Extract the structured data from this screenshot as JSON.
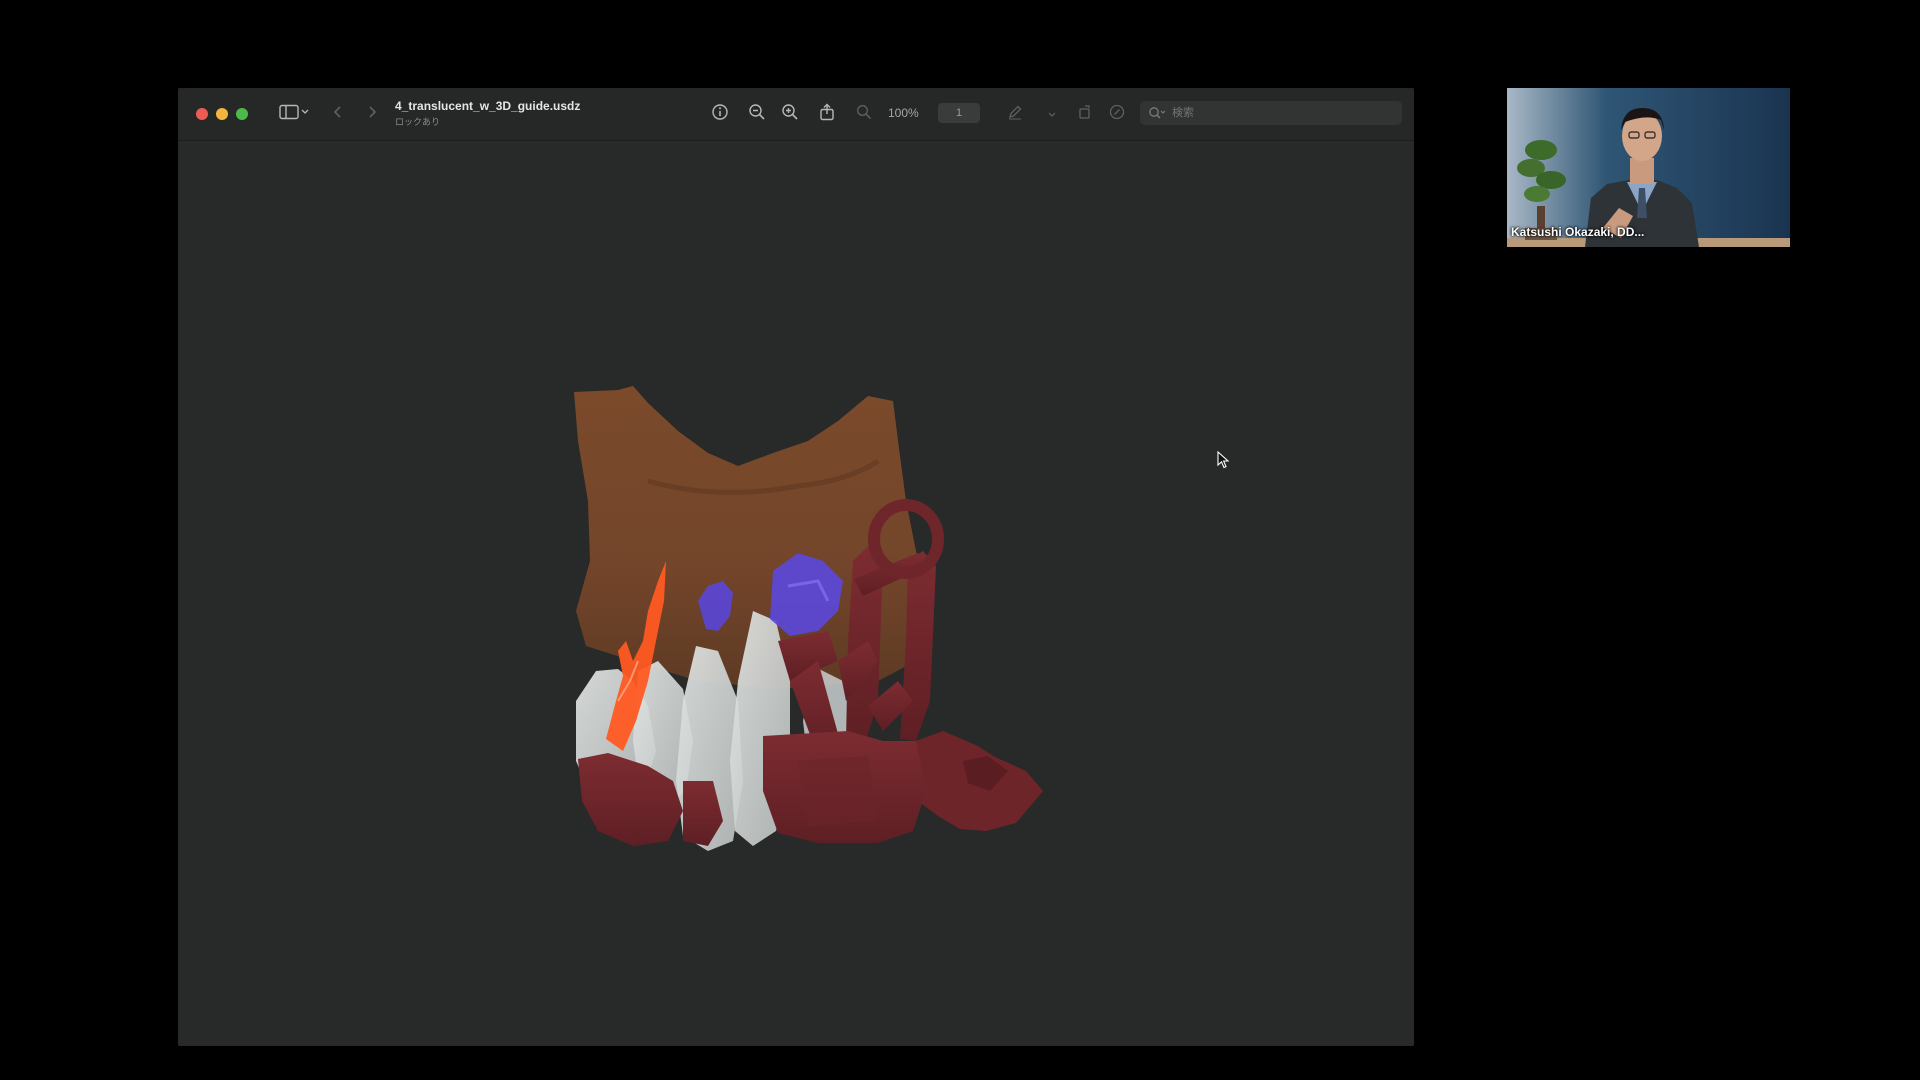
{
  "window": {
    "title": "4_translucent_w_3D_guide.usdz",
    "subtitle": "ロックあり",
    "zoom": "100%",
    "page_number": "1",
    "search_placeholder": "検索"
  },
  "video": {
    "participant_name": "Katsushi Okazaki, DD..."
  },
  "icons": {
    "sidebar": "sidebar-icon",
    "back": "chevron-left-icon",
    "forward": "chevron-right-icon",
    "info": "info-icon",
    "zoom_out": "zoom-out-icon",
    "zoom_in": "zoom-in-icon",
    "share": "share-icon",
    "zoom_fit": "zoom-fit-icon",
    "markup": "pen-icon",
    "rotate": "rotate-icon",
    "annotate": "annotate-icon",
    "search": "search-icon"
  },
  "colors": {
    "close": "#ee5b52",
    "minimize": "#f3b63c",
    "maximize": "#4cba48",
    "bone": "#7a4a2c",
    "guide": "#7a2b30",
    "teeth": "#cfd3d2",
    "nerve": "#ff5a28",
    "sinus": "#5a46d8"
  }
}
